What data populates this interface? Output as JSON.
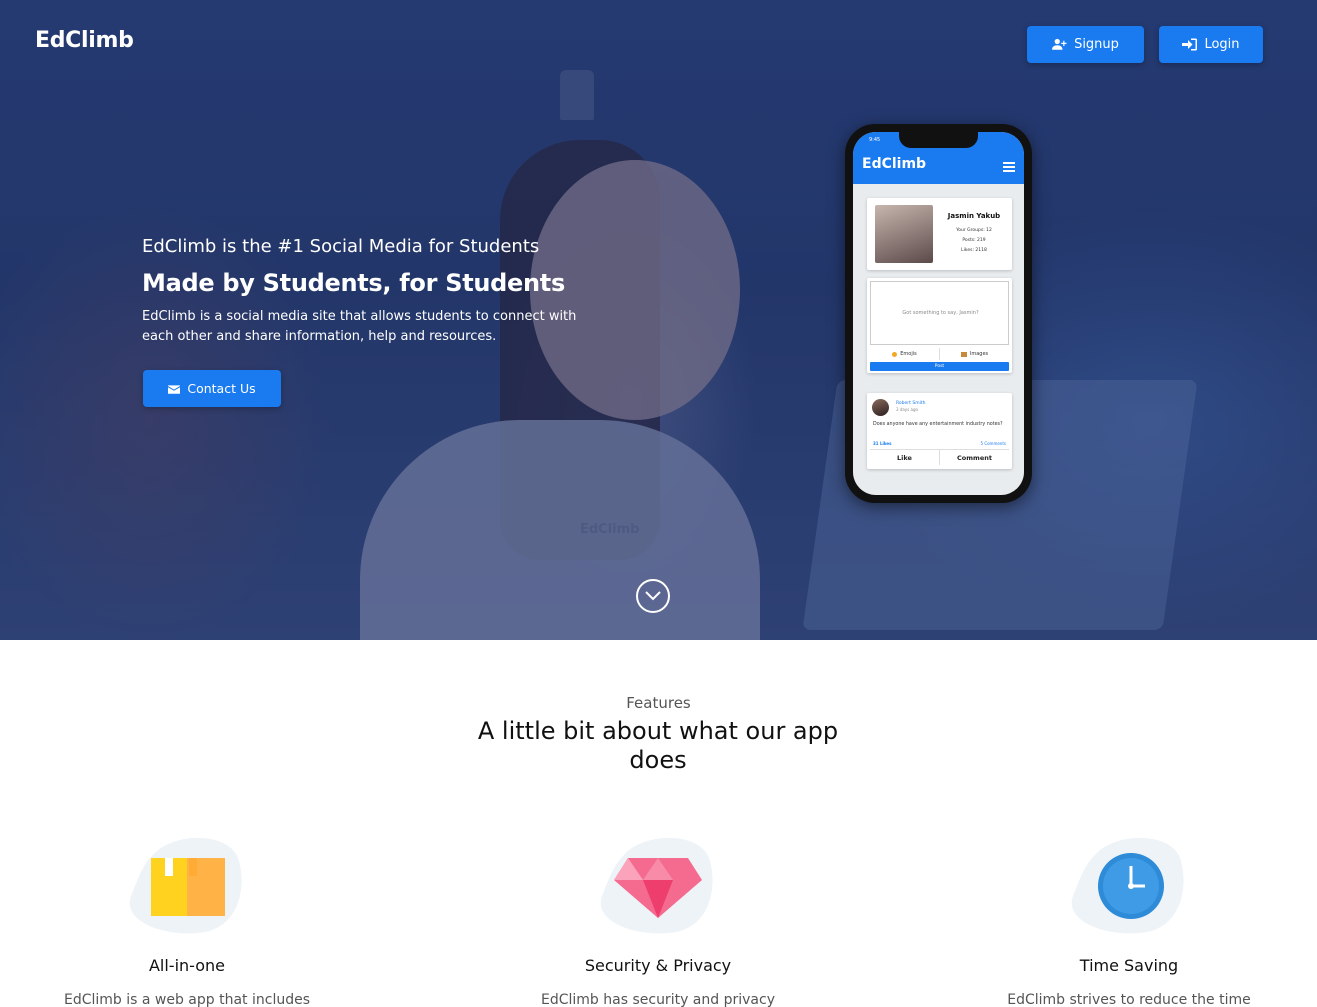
{
  "nav": {
    "brand": "EdClimb",
    "signup_label": "Signup",
    "login_label": "Login"
  },
  "hero": {
    "kicker": "EdClimb is the #1 Social Media for Students",
    "title": "Made by Students, for Students",
    "description": "EdClimb is a social media site that allows students to connect with each other and share information, help and resources.",
    "contact_label": "Contact Us",
    "shirt_text": "EdClimb"
  },
  "phone": {
    "time": "9:45",
    "brand": "EdClimb",
    "profile": {
      "name": "Jasmin Yakub",
      "group": "Your Groups: 12",
      "posts": "Posts: 219",
      "likes": "Likes: 2118"
    },
    "composer": {
      "placeholder": "Got something to say, Jasmin?",
      "emojis_label": "Emojis",
      "images_label": "Images",
      "post_label": "Post"
    },
    "feed": {
      "author": "Robert Smith",
      "time": "3 days ago",
      "text": "Does anyone have any entertainment industry notes?",
      "likes": "31 Likes",
      "comments": "5 Comments",
      "like_label": "Like",
      "comment_label": "Comment"
    }
  },
  "features": {
    "kicker": "Features",
    "title": "A little bit about what our app does",
    "items": [
      {
        "heading": "All-in-one",
        "text": "EdClimb is a web app that includes",
        "icon": "box-icon"
      },
      {
        "heading": "Security & Privacy",
        "text": "EdClimb has security and privacy",
        "icon": "diamond-icon"
      },
      {
        "heading": "Time Saving",
        "text": "EdClimb strives to reduce the time",
        "icon": "clock-icon"
      }
    ]
  },
  "colors": {
    "accent": "#1a7bf0",
    "hero_overlay": "#1e3a78"
  }
}
